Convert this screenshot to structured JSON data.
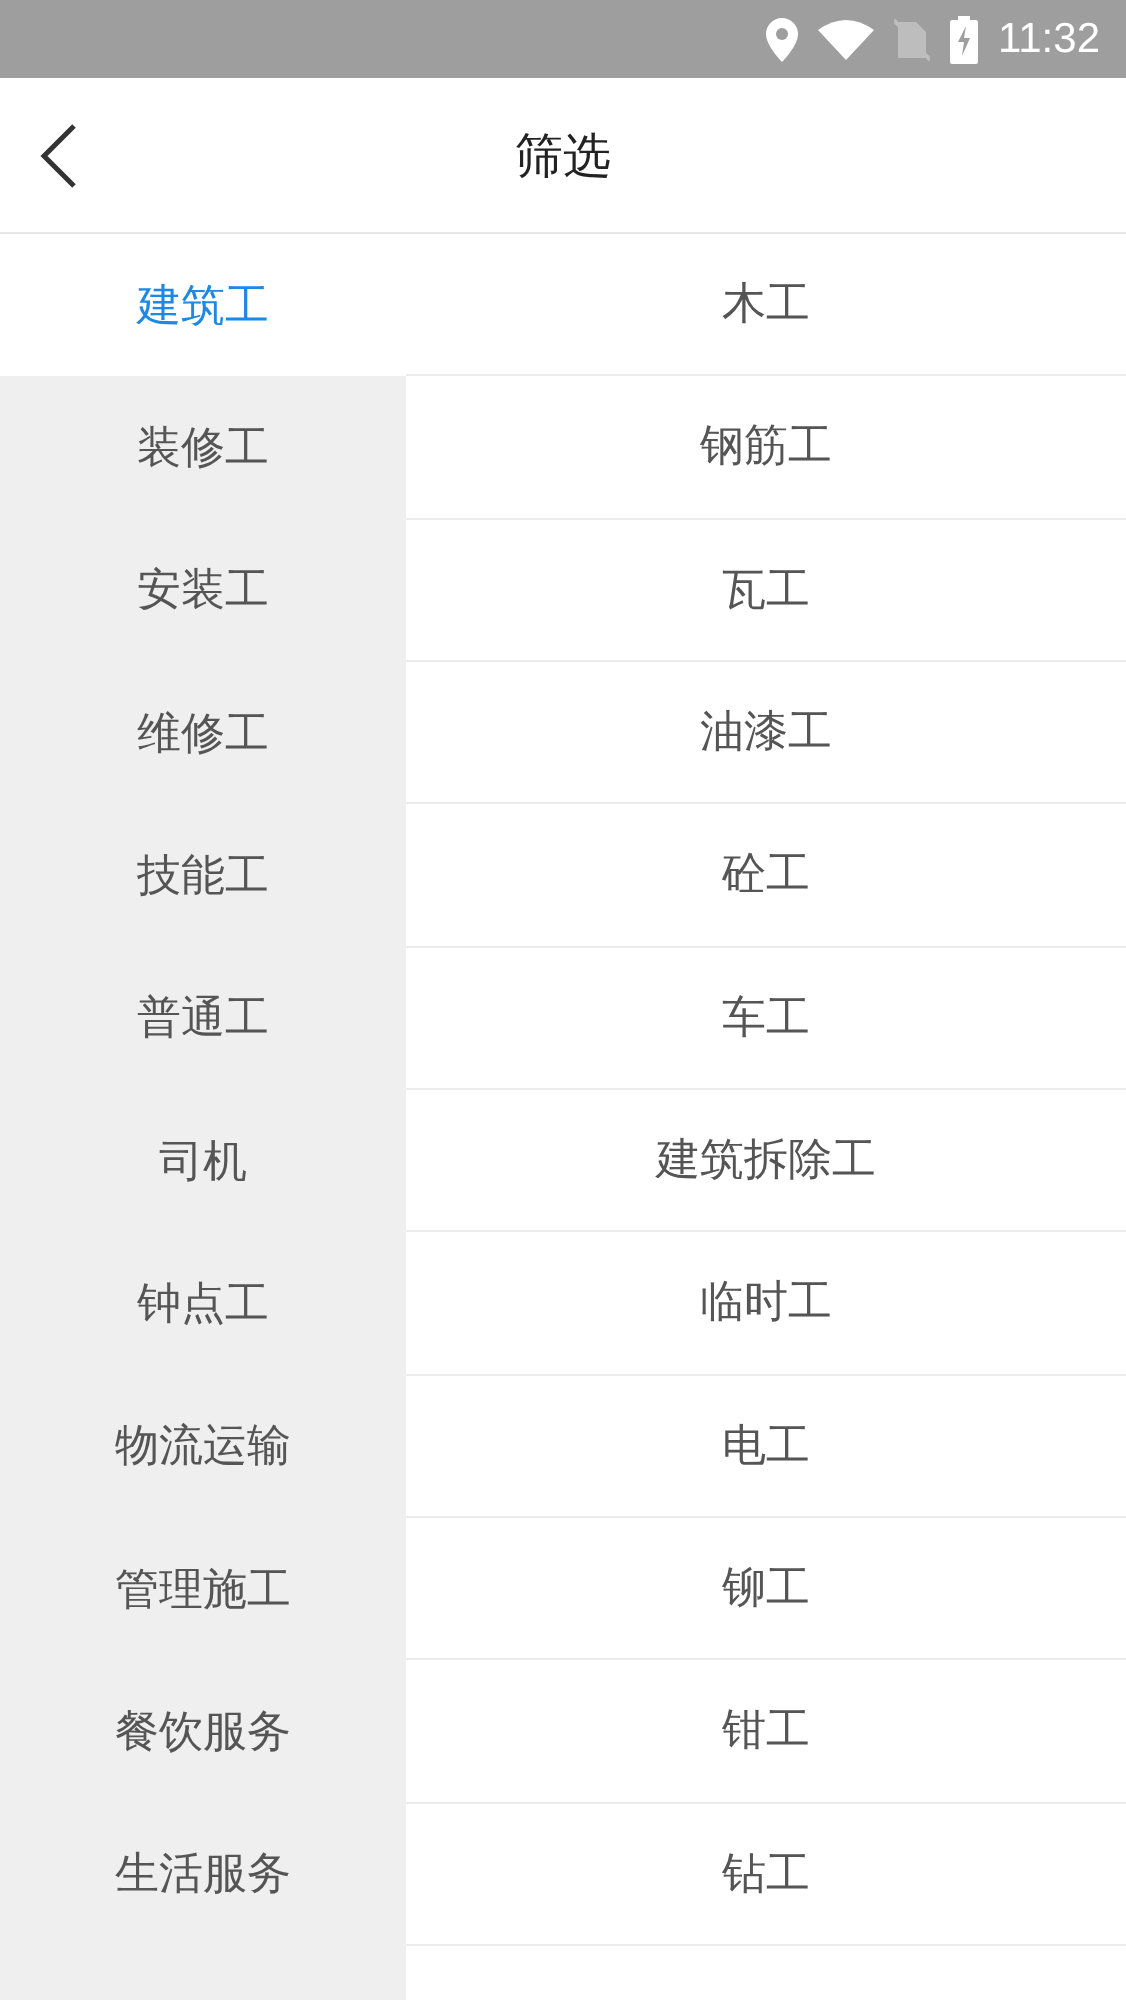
{
  "status_bar": {
    "time": "11:32"
  },
  "header": {
    "title": "筛选"
  },
  "categories": [
    {
      "label": "建筑工",
      "selected": true
    },
    {
      "label": "装修工",
      "selected": false
    },
    {
      "label": "安装工",
      "selected": false
    },
    {
      "label": "维修工",
      "selected": false
    },
    {
      "label": "技能工",
      "selected": false
    },
    {
      "label": "普通工",
      "selected": false
    },
    {
      "label": "司机",
      "selected": false
    },
    {
      "label": "钟点工",
      "selected": false
    },
    {
      "label": "物流运输",
      "selected": false
    },
    {
      "label": "管理施工",
      "selected": false
    },
    {
      "label": "餐饮服务",
      "selected": false
    },
    {
      "label": "生活服务",
      "selected": false
    }
  ],
  "trades": [
    "木工",
    "钢筋工",
    "瓦工",
    "油漆工",
    "砼工",
    "车工",
    "建筑拆除工",
    "临时工",
    "电工",
    "铆工",
    "钳工",
    "钻工"
  ]
}
